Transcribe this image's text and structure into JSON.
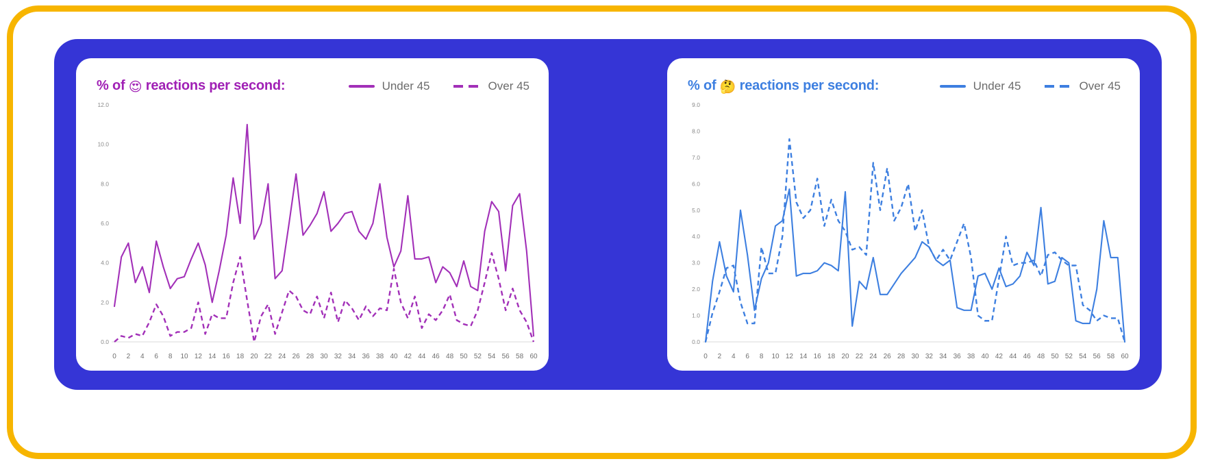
{
  "frame": {
    "border_color": "#F7B500",
    "panel_color": "#3535D6",
    "card_color": "#FFFFFF"
  },
  "charts": [
    {
      "id": "love-reactions",
      "title_prefix": "% of ",
      "emoji": "😍",
      "emoji_name": "smiling-face-with-heart-eyes",
      "title_suffix": " reactions per second:",
      "title_color": "#A020B5",
      "legend": [
        {
          "label": "Under 45",
          "style": "solid",
          "color": "#A230B8"
        },
        {
          "label": "Over 45",
          "style": "dashed",
          "color": "#A230B8"
        }
      ],
      "chart_data": {
        "type": "line",
        "title": "% of 😍 reactions per second:",
        "xlabel": "",
        "ylabel": "",
        "xlim": [
          0,
          60
        ],
        "ylim": [
          0.0,
          12.0
        ],
        "ytick_step": 2.0,
        "xtick_step": 2,
        "yticks": [
          "0.0",
          "2.0",
          "4.0",
          "6.0",
          "8.0",
          "10.0",
          "12.0"
        ],
        "xticks": [
          0,
          2,
          4,
          6,
          8,
          10,
          12,
          14,
          16,
          18,
          20,
          22,
          24,
          26,
          28,
          30,
          32,
          34,
          36,
          38,
          40,
          42,
          44,
          46,
          48,
          50,
          52,
          54,
          56,
          58,
          60
        ],
        "grid": false,
        "legend_position": "top-right",
        "x": [
          0,
          1,
          2,
          3,
          4,
          5,
          6,
          7,
          8,
          9,
          10,
          11,
          12,
          13,
          14,
          15,
          16,
          17,
          18,
          19,
          20,
          21,
          22,
          23,
          24,
          25,
          26,
          27,
          28,
          29,
          30,
          31,
          32,
          33,
          34,
          35,
          36,
          37,
          38,
          39,
          40,
          41,
          42,
          43,
          44,
          45,
          46,
          47,
          48,
          49,
          50,
          51,
          52,
          53,
          54,
          55,
          56,
          57,
          58,
          59,
          60
        ],
        "series": [
          {
            "name": "Under 45",
            "style": "solid",
            "color": "#A230B8",
            "values": [
              1.8,
              4.3,
              5.0,
              3.0,
              3.8,
              2.5,
              5.1,
              3.8,
              2.7,
              3.2,
              3.3,
              4.2,
              5.0,
              3.9,
              2.0,
              3.6,
              5.4,
              8.3,
              6.0,
              11.0,
              5.2,
              6.0,
              8.0,
              3.2,
              3.6,
              6.0,
              8.5,
              5.4,
              5.9,
              6.5,
              7.6,
              5.6,
              6.0,
              6.5,
              6.6,
              5.6,
              5.2,
              6.0,
              8.0,
              5.3,
              3.8,
              4.6,
              7.4,
              4.2,
              4.2,
              4.3,
              3.0,
              3.8,
              3.5,
              2.8,
              4.1,
              2.8,
              2.6,
              5.6,
              7.1,
              6.6,
              3.6,
              6.9,
              7.5,
              4.6,
              0.3
            ]
          },
          {
            "name": "Over 45",
            "style": "dashed",
            "color": "#A230B8",
            "values": [
              0.0,
              0.3,
              0.2,
              0.4,
              0.3,
              1.0,
              1.9,
              1.3,
              0.3,
              0.5,
              0.5,
              0.7,
              2.0,
              0.4,
              1.4,
              1.2,
              1.2,
              3.0,
              4.3,
              2.1,
              0.0,
              1.3,
              1.9,
              0.4,
              1.5,
              2.6,
              2.3,
              1.6,
              1.4,
              2.3,
              1.2,
              2.5,
              1.0,
              2.1,
              1.7,
              1.1,
              1.8,
              1.3,
              1.7,
              1.6,
              3.7,
              2.0,
              1.2,
              2.3,
              0.7,
              1.4,
              1.1,
              1.6,
              2.4,
              1.1,
              0.9,
              0.8,
              1.6,
              3.0,
              4.5,
              3.2,
              1.6,
              2.7,
              1.6,
              1.0,
              0.0
            ]
          }
        ]
      }
    },
    {
      "id": "thinking-reactions",
      "title_prefix": "% of ",
      "emoji": "🤔",
      "emoji_name": "thinking-face",
      "title_suffix": " reactions per second:",
      "title_color": "#3D7FE0",
      "legend": [
        {
          "label": "Under 45",
          "style": "solid",
          "color": "#3D7FE0"
        },
        {
          "label": "Over 45",
          "style": "dashed",
          "color": "#3D7FE0"
        }
      ],
      "chart_data": {
        "type": "line",
        "title": "% of 🤔 reactions per second:",
        "xlabel": "",
        "ylabel": "",
        "xlim": [
          0,
          60
        ],
        "ylim": [
          0.0,
          9.0
        ],
        "ytick_step": 1.0,
        "xtick_step": 2,
        "yticks": [
          "0.0",
          "1.0",
          "2.0",
          "3.0",
          "4.0",
          "5.0",
          "6.0",
          "7.0",
          "8.0",
          "9.0"
        ],
        "xticks": [
          0,
          2,
          4,
          6,
          8,
          10,
          12,
          14,
          16,
          18,
          20,
          22,
          24,
          26,
          28,
          30,
          32,
          34,
          36,
          38,
          40,
          42,
          44,
          46,
          48,
          50,
          52,
          54,
          56,
          58,
          60
        ],
        "grid": false,
        "legend_position": "top-right",
        "x": [
          0,
          1,
          2,
          3,
          4,
          5,
          6,
          7,
          8,
          9,
          10,
          11,
          12,
          13,
          14,
          15,
          16,
          17,
          18,
          19,
          20,
          21,
          22,
          23,
          24,
          25,
          26,
          27,
          28,
          29,
          30,
          31,
          32,
          33,
          34,
          35,
          36,
          37,
          38,
          39,
          40,
          41,
          42,
          43,
          44,
          45,
          46,
          47,
          48,
          49,
          50,
          51,
          52,
          53,
          54,
          55,
          56,
          57,
          58,
          59,
          60
        ],
        "series": [
          {
            "name": "Under 45",
            "style": "solid",
            "color": "#3D7FE0",
            "values": [
              0.0,
              2.3,
              3.8,
              2.5,
              1.9,
              5.0,
              3.3,
              1.2,
              2.4,
              3.0,
              4.4,
              4.6,
              5.8,
              2.5,
              2.6,
              2.6,
              2.7,
              3.0,
              2.9,
              2.7,
              5.7,
              0.6,
              2.3,
              2.0,
              3.2,
              1.8,
              1.8,
              2.2,
              2.6,
              2.9,
              3.2,
              3.8,
              3.6,
              3.1,
              2.9,
              3.1,
              1.3,
              1.2,
              1.2,
              2.5,
              2.6,
              2.0,
              2.8,
              2.1,
              2.2,
              2.5,
              3.4,
              2.9,
              5.1,
              2.2,
              2.3,
              3.2,
              3.0,
              0.8,
              0.7,
              0.7,
              2.0,
              4.6,
              3.2,
              3.2,
              0.0
            ]
          },
          {
            "name": "Over 45",
            "style": "dashed",
            "color": "#3D7FE0",
            "values": [
              0.0,
              1.1,
              1.9,
              2.8,
              2.9,
              1.5,
              0.7,
              0.7,
              3.6,
              2.6,
              2.6,
              4.0,
              7.7,
              5.3,
              4.7,
              5.0,
              6.2,
              4.4,
              5.4,
              4.6,
              4.2,
              3.5,
              3.6,
              3.3,
              6.8,
              5.0,
              6.6,
              4.6,
              5.1,
              6.0,
              4.2,
              5.0,
              3.6,
              3.1,
              3.5,
              3.1,
              3.8,
              4.5,
              3.2,
              1.0,
              0.8,
              0.8,
              2.4,
              4.0,
              2.9,
              3.0,
              3.0,
              3.1,
              2.5,
              3.3,
              3.4,
              3.1,
              2.9,
              2.9,
              1.4,
              1.2,
              0.8,
              1.0,
              0.9,
              0.9,
              0.0
            ]
          }
        ]
      }
    }
  ]
}
